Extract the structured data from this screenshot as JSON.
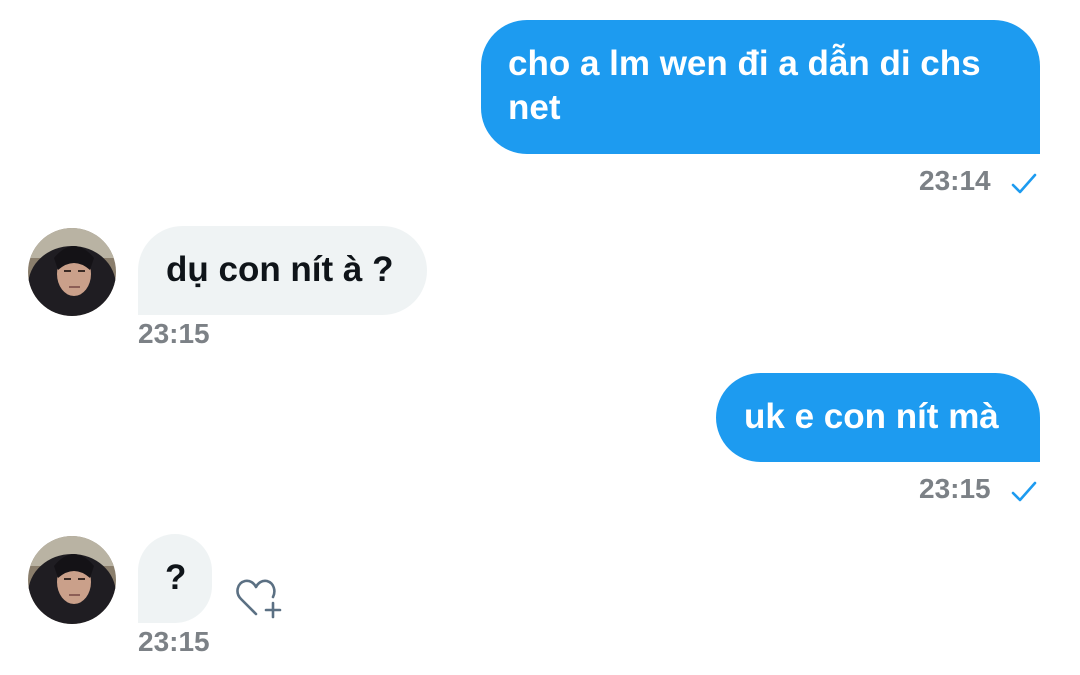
{
  "messages": [
    {
      "direction": "outgoing",
      "text": "cho a lm wen đi a dẫn di chs net",
      "line1": "cho a lm wen đi a dẫn di chs",
      "line2": "net",
      "time": "23:14",
      "status_icon": "check-icon"
    },
    {
      "direction": "incoming",
      "text": "dụ con nít à ?",
      "time": "23:15",
      "avatar_icon": "contact-avatar"
    },
    {
      "direction": "outgoing",
      "text": "uk e con nít mà",
      "time": "23:15",
      "status_icon": "check-icon"
    },
    {
      "direction": "incoming",
      "text": "?",
      "time": "23:15",
      "avatar_icon": "contact-avatar",
      "reaction_icon": "heart-plus-icon"
    }
  ],
  "colors": {
    "outgoing_bubble": "#1d9bf0",
    "incoming_bubble": "#eff3f4",
    "timestamp": "#7c8186",
    "check": "#1d9bf0"
  }
}
